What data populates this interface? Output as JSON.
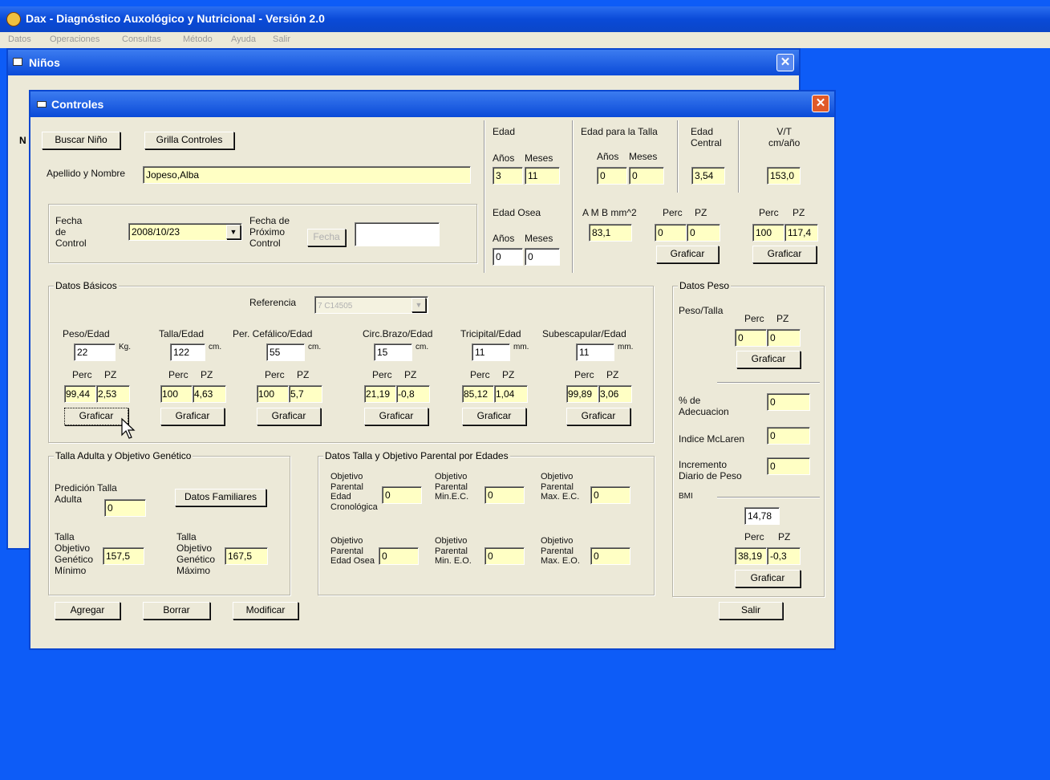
{
  "app": {
    "title": "Dax - Diagnóstico Auxológico y Nutricional - Versión 2.0",
    "menu": [
      "Datos",
      "Operaciones",
      "Consultas",
      "Método",
      "Ayuda",
      "Salir"
    ]
  },
  "ninos_window": {
    "title": "Niños",
    "side_letter": "N"
  },
  "controles": {
    "title": "Controles",
    "buscar_nino": "Buscar Niño",
    "grilla_controles": "Grilla Controles",
    "apellido_label": "Apellido y Nombre",
    "apellido_value": "Jopeso,Alba",
    "fecha_control_label": "Fecha\nde\nControl",
    "fecha_control_value": "2008/10/23",
    "fecha_proximo_label": "Fecha de\nPróximo\nControl",
    "fecha_button": "Fecha",
    "fecha_proximo_value": "",
    "edad": {
      "label": "Edad",
      "anos_label": "Años",
      "meses_label": "Meses",
      "anos": "3",
      "meses": "11"
    },
    "edad_talla": {
      "label": "Edad para la Talla",
      "anos_label": "Años",
      "meses_label": "Meses",
      "anos": "0",
      "meses": "0"
    },
    "edad_central": {
      "label": "Edad\nCentral",
      "value": "3,54"
    },
    "vt": {
      "label": "V/T\ncm/año",
      "value": "153,0",
      "perc_label": "Perc",
      "pz_label": "PZ",
      "perc": "100",
      "pz": "117,4",
      "graficar": "Graficar"
    },
    "edad_osea": {
      "label": "Edad Osea",
      "anos_label": "Años",
      "meses_label": "Meses",
      "anos": "0",
      "meses": "0"
    },
    "amb": {
      "label": "A M B mm^2",
      "value": "83,1",
      "perc_label": "Perc",
      "pz_label": "PZ",
      "perc": "0",
      "pz": "0",
      "graficar": "Graficar"
    },
    "datos_basicos": {
      "title": "Datos Básicos",
      "referencia_label": "Referencia",
      "referencia_value": "7 C14505",
      "perc_label": "Perc",
      "pz_label": "PZ",
      "graficar": "Graficar",
      "items": [
        {
          "label": "Peso/Edad",
          "value": "22",
          "unit": "Kg.",
          "perc": "99,44",
          "pz": "2,53"
        },
        {
          "label": "Talla/Edad",
          "value": "122",
          "unit": "cm.",
          "perc": "100",
          "pz": "4,63"
        },
        {
          "label": "Per. Cefálico/Edad",
          "value": "55",
          "unit": "cm.",
          "perc": "100",
          "pz": "5,7"
        },
        {
          "label": "Circ.Brazo/Edad",
          "value": "15",
          "unit": "cm.",
          "perc": "21,19",
          "pz": "-0,8"
        },
        {
          "label": "Tricipital/Edad",
          "value": "11",
          "unit": "mm.",
          "perc": "85,12",
          "pz": "1,04"
        },
        {
          "label": "Subescapular/Edad",
          "value": "11",
          "unit": "mm.",
          "perc": "99,89",
          "pz": "3,06"
        }
      ]
    },
    "datos_peso": {
      "title": "Datos Peso",
      "peso_talla_label": "Peso/Talla",
      "perc_label": "Perc",
      "pz_label": "PZ",
      "perc": "0",
      "pz": "0",
      "graficar": "Graficar",
      "adecuacion_label": "% de\nAdecuacion",
      "adecuacion": "0",
      "mclaren_label": "Indice McLaren",
      "mclaren": "0",
      "incremento_label": "Incremento\nDiario de Peso",
      "incremento": "0",
      "bmi_label": "BMI",
      "bmi": "14,78",
      "bmi_perc": "38,19",
      "bmi_pz": "-0,3",
      "bmi_graficar": "Graficar"
    },
    "talla_adulta": {
      "title": "Talla Adulta y Objetivo Genético",
      "prediccion_label": "Predición Talla\nAdulta",
      "prediccion": "0",
      "datos_familiares": "Datos Familiares",
      "min_label": "Talla\nObjetivo\nGenético\nMínimo",
      "min": "157,5",
      "max_label": "Talla\nObjetivo\nGenético\nMáximo",
      "max": "167,5"
    },
    "parental": {
      "title": "Datos Talla y Objetivo Parental por Edades",
      "items": [
        {
          "label": "Objetivo\nParental\nEdad\nCronológica",
          "value": "0"
        },
        {
          "label": "Objetivo\nParental\nMin.E.C.",
          "value": "0"
        },
        {
          "label": "Objetivo\nParental\nMax. E.C.",
          "value": "0"
        },
        {
          "label": "Objetivo\nParental\nEdad Osea",
          "value": "0"
        },
        {
          "label": "Objetivo\nParental\nMin. E.O.",
          "value": "0"
        },
        {
          "label": "Objetivo\nParental\nMax. E.O.",
          "value": "0"
        }
      ]
    },
    "agregar": "Agregar",
    "borrar": "Borrar",
    "modificar": "Modificar",
    "salir": "Salir"
  }
}
